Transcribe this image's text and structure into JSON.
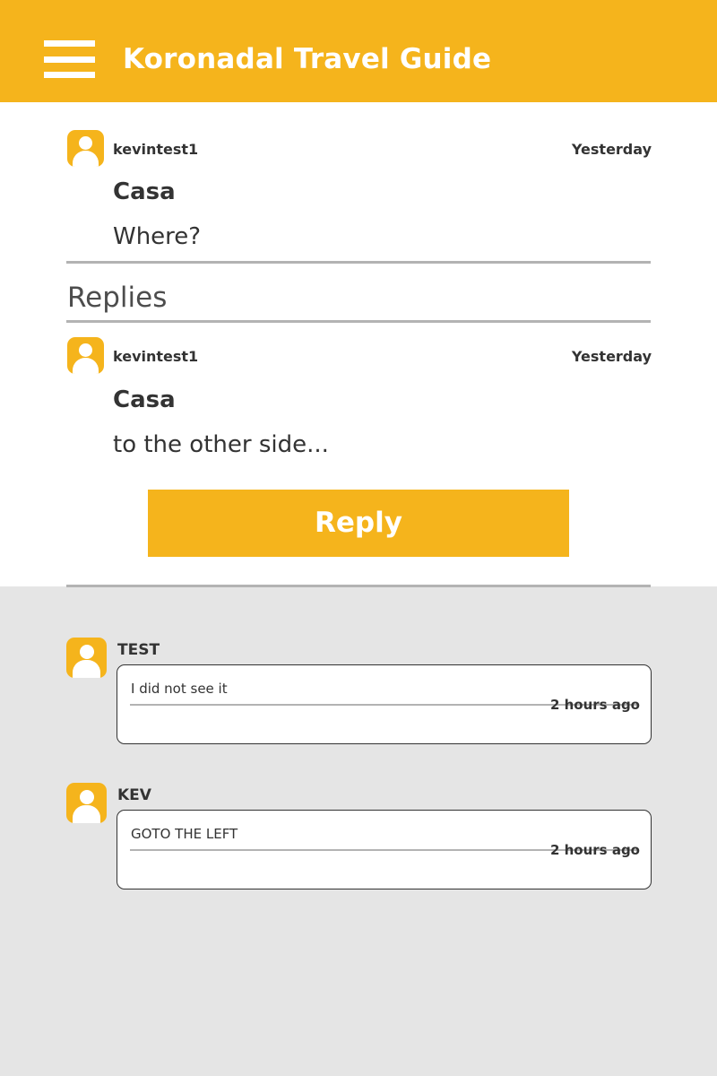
{
  "header": {
    "title": "Koronadal Travel Guide",
    "menu_icon": "hamburger-menu-icon",
    "color": "#f5b41c"
  },
  "post": {
    "username": "kevintest1",
    "time": "Yesterday",
    "title": "Casa",
    "body": "Where?"
  },
  "replies_heading": "Replies",
  "reply": {
    "username": "kevintest1",
    "time": "Yesterday",
    "title": "Casa",
    "body": "to the other side..."
  },
  "reply_button_label": "Reply",
  "comments": [
    {
      "name": "TEST",
      "text": "I did not see it",
      "time": "2 hours ago"
    },
    {
      "name": "KEV",
      "text": "GOTO THE LEFT",
      "time": "2 hours ago"
    }
  ],
  "colors": {
    "accent": "#f5b41c",
    "background": "#e5e5e5",
    "text": "#333333",
    "divider": "#b3b3b3"
  }
}
